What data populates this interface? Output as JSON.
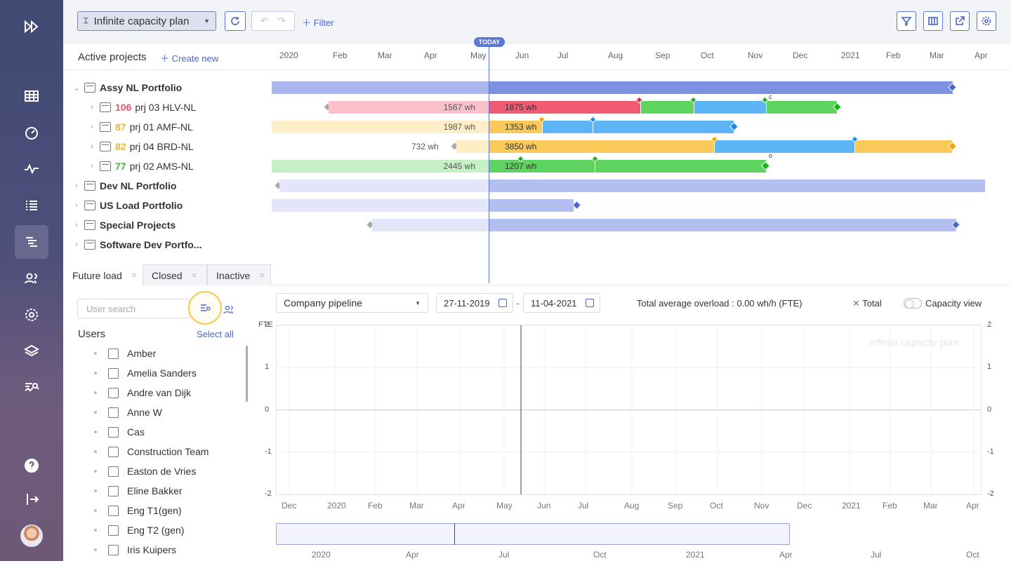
{
  "sidebar": {
    "icons": [
      "logo-icon",
      "grid-icon",
      "dashboard-icon",
      "activity-icon",
      "list-icon",
      "gantt-icon",
      "users-icon",
      "settings-icon",
      "layers-icon",
      "analytics-icon",
      "help-icon",
      "logout-icon"
    ]
  },
  "toolbar": {
    "plan_label": "Infinite capacity plan",
    "filter_label": "Filter"
  },
  "gantt": {
    "title": "Active projects",
    "create_new": "Create new",
    "today_label": "TODAY",
    "months": [
      "2020",
      "Feb",
      "Mar",
      "Apr",
      "May",
      "Jun",
      "Jul",
      "Aug",
      "Sep",
      "Oct",
      "Nov",
      "Dec",
      "2021",
      "Feb",
      "Mar",
      "Apr"
    ],
    "rows": [
      {
        "name": "Assy NL Portfolio",
        "num": "",
        "level": 0,
        "expanded": true
      },
      {
        "name": "prj 03 HLV-NL",
        "num": "106",
        "num_color": "#e8506b",
        "level": 1
      },
      {
        "name": "prj 01 AMF-NL",
        "num": "87",
        "num_color": "#f5b531",
        "level": 1
      },
      {
        "name": "prj 04 BRD-NL",
        "num": "82",
        "num_color": "#f5b531",
        "level": 1
      },
      {
        "name": "prj 02 AMS-NL",
        "num": "77",
        "num_color": "#3cb63c",
        "level": 1
      },
      {
        "name": "Dev NL Portfolio",
        "num": "",
        "level": 0
      },
      {
        "name": "US Load Portfolio",
        "num": "",
        "level": 0
      },
      {
        "name": "Special Projects",
        "num": "",
        "level": 0
      },
      {
        "name": "Software Dev Portfo...",
        "num": "",
        "level": 0
      }
    ],
    "bar_labels": {
      "hlv_past": "1567 wh",
      "hlv_future": "1875 wh",
      "amf_past": "1987 wh",
      "amf_future": "1353 wh",
      "brd_past": "732 wh",
      "brd_future": "3850 wh",
      "ams_past": "2445 wh",
      "ams_future": "1207 wh"
    },
    "markers": {
      "hlv": "c",
      "ams": "o"
    }
  },
  "tabs": [
    {
      "label": "Future load",
      "active": true
    },
    {
      "label": "Closed",
      "active": false
    },
    {
      "label": "Inactive",
      "active": false
    }
  ],
  "users_panel": {
    "search_placeholder": "User search",
    "heading": "Users",
    "select_all": "Select all",
    "users": [
      "Amber",
      "Amelia Sanders",
      "Andre van Dijk",
      "Anne W",
      "Cas",
      "Construction Team",
      "Easton de Vries",
      "Eline Bakker",
      "Eng T1(gen)",
      "Eng T2 (gen)",
      "Iris Kuipers"
    ]
  },
  "load_chart": {
    "pipeline": "Company pipeline",
    "date_from": "27-11-2019",
    "date_sep": "-",
    "date_to": "11-04-2021",
    "overload": "Total average overload : 0.00 wh/h (FTE)",
    "total_label": "Total",
    "capacity_view": "Capacity view",
    "watermark": "Infinite capacity plan",
    "unit": "FTE"
  },
  "chart_data": {
    "type": "line",
    "ylabel": "FTE",
    "ylim": [
      -2,
      2
    ],
    "yticks": [
      "2",
      "1",
      "0",
      "-1",
      "-2"
    ],
    "x_ticks": [
      "Dec",
      "2020",
      "Feb",
      "Mar",
      "Apr",
      "May",
      "Jun",
      "Jul",
      "Aug",
      "Sep",
      "Oct",
      "Nov",
      "Dec",
      "2021",
      "Feb",
      "Mar",
      "Apr"
    ],
    "series": [
      {
        "name": "Total",
        "values": [
          0,
          0,
          0,
          0,
          0,
          0,
          0,
          0,
          0,
          0,
          0,
          0,
          0,
          0,
          0,
          0,
          0
        ]
      }
    ],
    "navigator_ticks": [
      "2020",
      "Apr",
      "Jul",
      "Oct",
      "2021",
      "Apr",
      "Jul",
      "Oct"
    ],
    "grid": true
  },
  "colors": {
    "accent": "#4a67c9",
    "sidebar_top": "#3f4a72",
    "portfolio_bar": "#a3b1ec",
    "red": "#f05a72",
    "orange": "#fbc95a",
    "blue": "#5db5f5",
    "green": "#5fd35f"
  }
}
